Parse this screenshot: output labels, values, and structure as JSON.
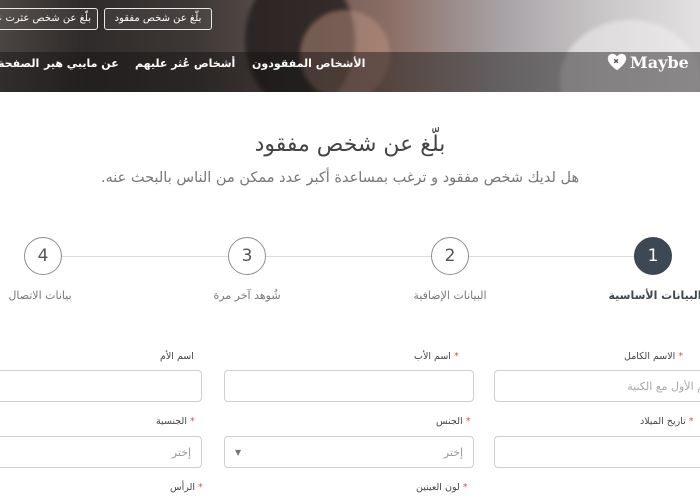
{
  "header": {
    "report_missing_button": "بلّغ عن شخص مفقود",
    "report_found_button": "بلّغ عن شخص عثرت عليه",
    "nav": {
      "missing": "الأشخاص المفقودون",
      "found": "أشخاص عُثر عليهم",
      "about": "عن مايبي هير",
      "home": "الصفحة"
    },
    "logo": {
      "text": "Maybe",
      "icon": "heart-icon"
    }
  },
  "page": {
    "title": "بلّغ عن شخص مفقود",
    "subtitle": "هل لديك شخص مفقود و ترغب بمساعدة أكبر عدد ممكن من الناس بالبحث عنه."
  },
  "stepper": {
    "steps": [
      {
        "number": "1",
        "label": "البيانات الأساسية",
        "active": true
      },
      {
        "number": "2",
        "label": "البيانات الإضافية",
        "active": false
      },
      {
        "number": "3",
        "label": "شُوهد آخر مرة",
        "active": false
      },
      {
        "number": "4",
        "label": "بيانات الاتصال",
        "active": false
      }
    ]
  },
  "form": {
    "full_name": {
      "label": "الاسم الكامل",
      "placeholder": "الاسم الأول مع الكنية"
    },
    "father_name": {
      "label": "اسم الأب"
    },
    "mother_name": {
      "label": "اسم الأم"
    },
    "birth_date": {
      "label": "تاريخ الميلاد"
    },
    "gender": {
      "label": "الجنس",
      "value": "إختر"
    },
    "nationality": {
      "label": "الجنسية",
      "value": "إختر"
    },
    "eye_color": {
      "label": "لون العينين"
    },
    "head": {
      "label": "الرأس"
    }
  },
  "colors": {
    "accent": "#3e4754",
    "required": "#d9534f"
  }
}
